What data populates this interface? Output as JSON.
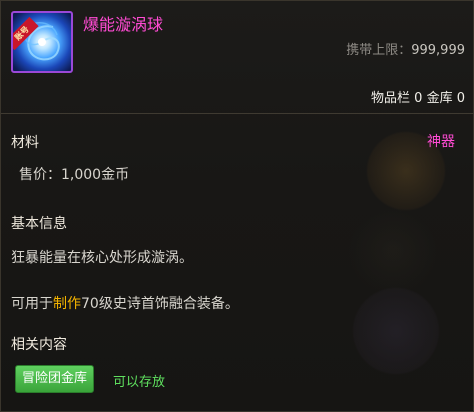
{
  "item": {
    "name": "爆能漩涡球",
    "badge": "账号",
    "carry_label": "携带上限：",
    "carry_value": "999,999",
    "storage_text": "物品栏 0 金库 0",
    "rarity": "神器"
  },
  "materials": {
    "title": "材料",
    "price": "售价：1,000金币"
  },
  "basic_info": {
    "title": "基本信息",
    "description": "狂暴能量在核心处形成漩涡。",
    "use_prefix": "可用于",
    "use_keyword": "制作",
    "use_suffix": "70级史诗首饰融合装备。"
  },
  "related": {
    "title": "相关内容",
    "vault_button": "冒险团金库",
    "storable": "可以存放"
  },
  "colors": {
    "rarity_pink": "#ff4bd3",
    "keyword_orange": "#f5b400",
    "button_green": "#4dbb4d",
    "store_green": "#5fe05f"
  }
}
